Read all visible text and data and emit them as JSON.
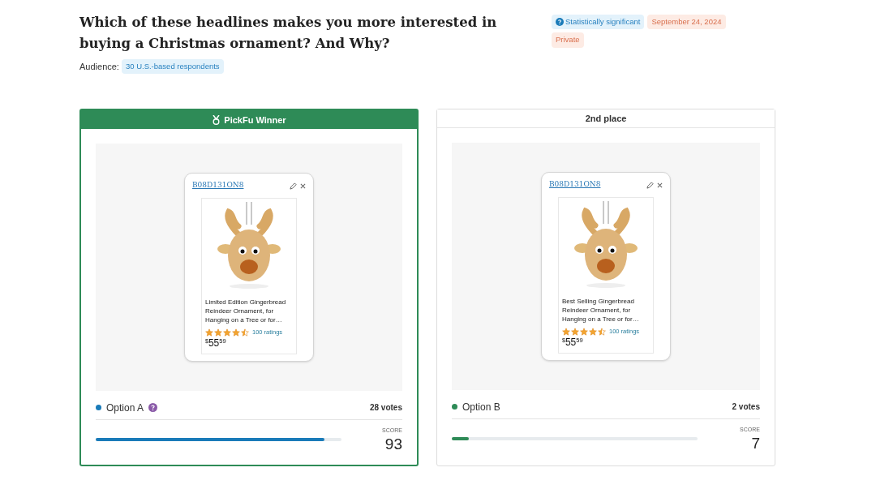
{
  "title": "Which of these headlines makes you more interested in buying a Christmas ornament? And Why?",
  "audience": {
    "label": "Audience:",
    "value": "30 U.S.-based respondents"
  },
  "tags": [
    {
      "kind": "info",
      "text": "Statistically significant"
    },
    {
      "kind": "warm",
      "text": "September 24, 2024"
    },
    {
      "kind": "warm",
      "text": "Private"
    }
  ],
  "options": [
    {
      "winner": true,
      "header": "PickFu Winner",
      "asin": "B08D131ON8",
      "product_title": "Limited Edition Gingerbread Reindeer Ornament, for Hanging on a Tree or for…",
      "stars": 4.5,
      "ratings": "100 ratings",
      "price_symbol": "$",
      "price_whole": "55",
      "price_fraction": "59",
      "name": "Option A",
      "color": "#1a7bb9",
      "help_icon": true,
      "votes": "28 votes",
      "score_label": "SCORE",
      "score": "93",
      "level": 0.93
    },
    {
      "winner": false,
      "header": "2nd place",
      "asin": "B08D131ON8",
      "product_title": "Best Selling Gingerbread Reindeer Ornament, for Hanging on a Tree or for…",
      "stars": 4.5,
      "ratings": "100 ratings",
      "price_symbol": "$",
      "price_whole": "55",
      "price_fraction": "59",
      "name": "Option B",
      "color": "#2e8b57",
      "help_icon": false,
      "votes": "2 votes",
      "score_label": "SCORE",
      "score": "7",
      "level": 0.07
    }
  ]
}
